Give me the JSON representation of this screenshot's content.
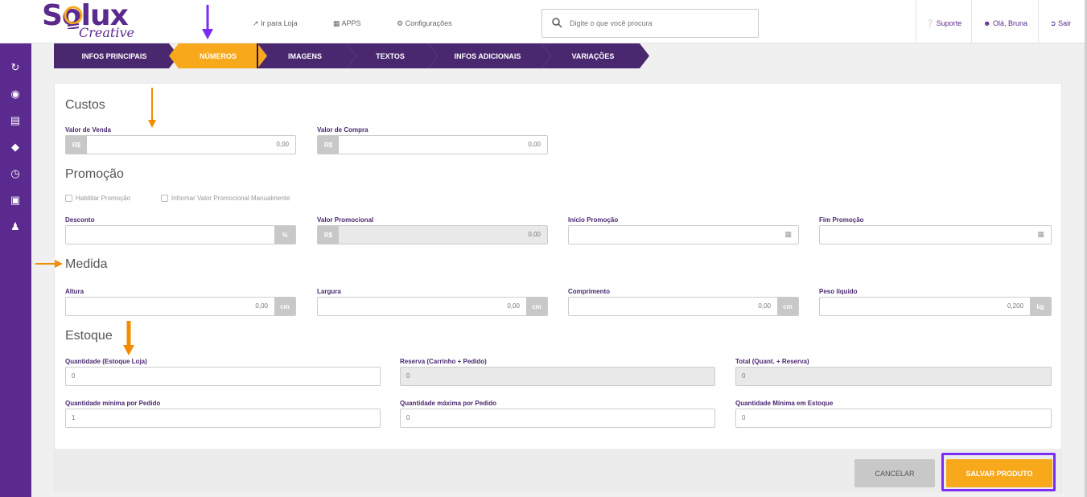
{
  "topbar": {
    "logo_main": "Solux",
    "logo_sub": "Creative",
    "nav": [
      {
        "label": "Ir para Loja",
        "icon": "external-link-icon"
      },
      {
        "label": "APPS",
        "icon": "grid-icon"
      },
      {
        "label": "Configurações",
        "icon": "gear-icon"
      }
    ],
    "search_placeholder": "Digite o que você procura",
    "support": "Suporte",
    "user": "Olá, Bruna",
    "logout": "Sair"
  },
  "sidebar": {
    "icons": [
      "dashboard-icon",
      "shopping-bag-icon",
      "document-icon",
      "tag-icon",
      "cart-icon",
      "box-icon",
      "users-icon"
    ]
  },
  "steps": [
    "INFOS PRINCIPAIS",
    "NÚMEROS",
    "IMAGENS",
    "TEXTOS",
    "INFOS ADICIONAIS",
    "VARIAÇÕES"
  ],
  "active_step": "NÚMEROS",
  "custos": {
    "title": "Custos",
    "venda_label": "Valor de Venda",
    "venda_value": "0,00",
    "compra_label": "Valor de Compra",
    "compra_value": "0,00",
    "currency": "R$"
  },
  "promocao": {
    "title": "Promoção",
    "habilitar": "Habilitar Promoção",
    "manual": "Informar Valor Promocional Manualmente",
    "desconto_label": "Desconto",
    "desconto_suffix": "%",
    "valor_label": "Valor Promocional",
    "valor_value": "0,00",
    "inicio_label": "Início Promoção",
    "fim_label": "Fim Promoção"
  },
  "medida": {
    "title": "Medida",
    "altura_label": "Altura",
    "altura_value": "0,00",
    "largura_label": "Largura",
    "largura_value": "0,00",
    "comprimento_label": "Comprimento",
    "comprimento_value": "0,00",
    "peso_label": "Peso líquido",
    "peso_value": "0,200",
    "unit_cm": "cm",
    "unit_kg": "kg"
  },
  "estoque": {
    "title": "Estoque",
    "quantidade_label": "Quantidade (Estoque Loja)",
    "quantidade_value": "0",
    "reserva_label": "Reserva (Carrinho + Pedido)",
    "reserva_value": "0",
    "total_label": "Total (Quant. + Reserva)",
    "total_value": "0",
    "min_pedido_label": "Quantidade mínima por Pedido",
    "min_pedido_value": "1",
    "max_pedido_label": "Quantidade máxima por Pedido",
    "max_pedido_value": "0",
    "min_estoque_label": "Quantidade Mínima em Estoque",
    "min_estoque_value": "0"
  },
  "actions": {
    "cancel": "CANCELAR",
    "save": "SALVAR PRODUTO"
  },
  "colors": {
    "brand_purple": "#5b2a8e",
    "step_purple": "#4a2870",
    "accent_orange": "#f7a81b",
    "annotation_purple": "#7b2cf5",
    "annotation_orange": "#f28c00"
  }
}
